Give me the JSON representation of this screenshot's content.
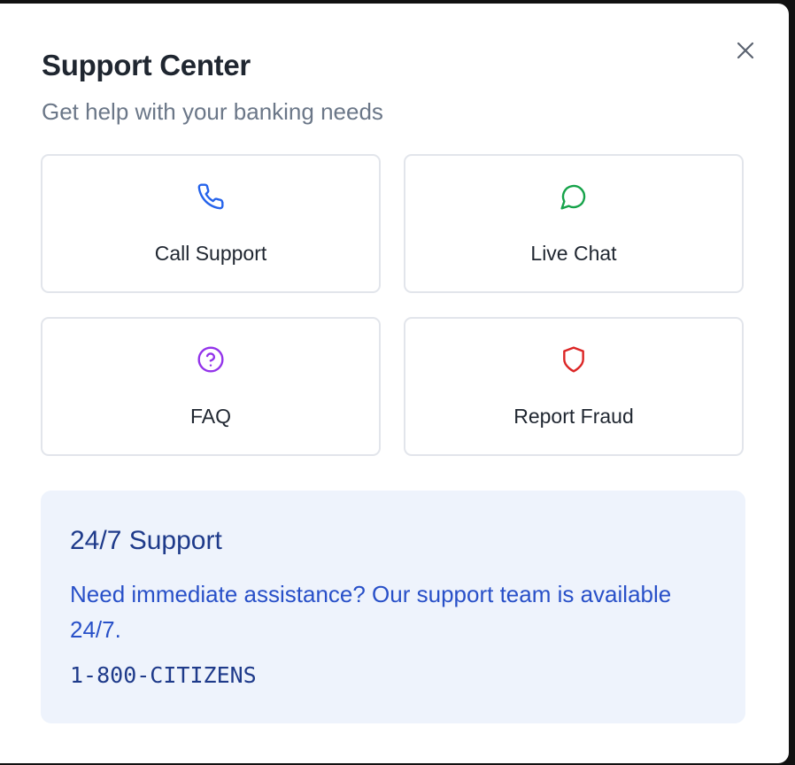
{
  "modal": {
    "title": "Support Center",
    "subtitle": "Get help with your banking needs",
    "close_icon": "close-icon"
  },
  "options": [
    {
      "label": "Call Support",
      "icon": "phone-icon",
      "color": "#2563eb"
    },
    {
      "label": "Live Chat",
      "icon": "chat-bubble-icon",
      "color": "#16a34a"
    },
    {
      "label": "FAQ",
      "icon": "help-circle-icon",
      "color": "#9333ea"
    },
    {
      "label": "Report Fraud",
      "icon": "shield-icon",
      "color": "#dc2626"
    }
  ],
  "support_info": {
    "title": "24/7 Support",
    "text": "Need immediate assistance? Our support team is available 24/7.",
    "phone": "1-800-CITIZENS",
    "background": "#eef3fc"
  }
}
